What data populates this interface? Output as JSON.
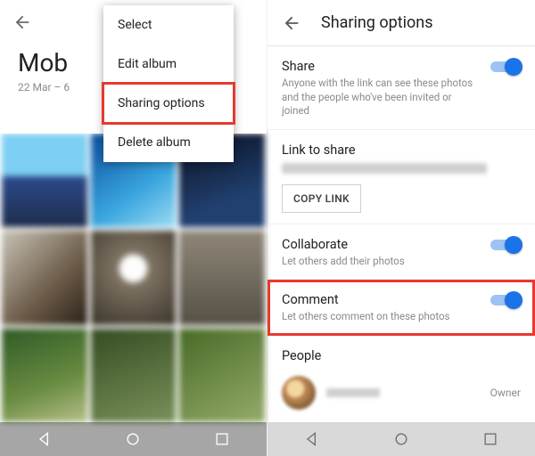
{
  "left": {
    "album_title": "Mob",
    "album_date": "22 Mar – 6",
    "menu": {
      "select": "Select",
      "edit": "Edit album",
      "sharing": "Sharing options",
      "delete": "Delete album"
    }
  },
  "right": {
    "title": "Sharing options",
    "share": {
      "label": "Share",
      "desc": "Anyone with the link can see these photos and the people who've been invited or joined"
    },
    "link": {
      "label": "Link to share",
      "copy_button": "COPY LINK"
    },
    "collaborate": {
      "label": "Collaborate",
      "desc": "Let others add their photos"
    },
    "comment": {
      "label": "Comment",
      "desc": "Let others comment on these photos"
    },
    "people": {
      "label": "People",
      "owner_label": "Owner"
    }
  }
}
